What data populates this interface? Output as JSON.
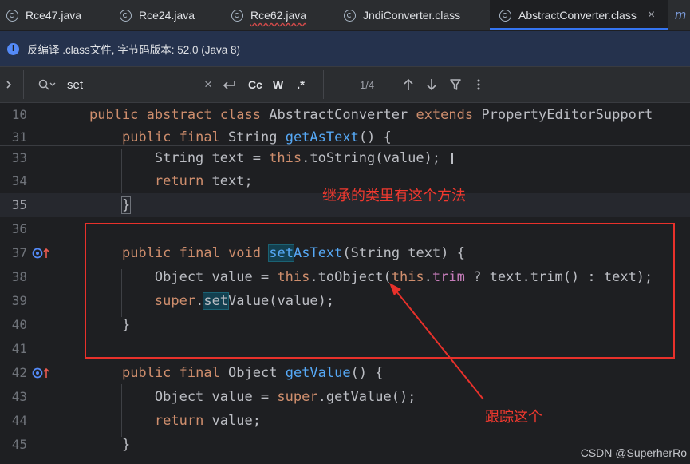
{
  "tabs": [
    {
      "label": "Rce47.java",
      "active": false,
      "error": false
    },
    {
      "label": "Rce24.java",
      "active": false,
      "error": false
    },
    {
      "label": "Rce62.java",
      "active": false,
      "error": true
    },
    {
      "label": "JndiConverter.class",
      "active": false,
      "error": false
    },
    {
      "label": "AbstractConverter.class",
      "active": true,
      "error": false
    }
  ],
  "tab_overflow_glyph": "m",
  "infobar": {
    "text": "反编译 .class文件, 字节码版本: 52.0 (Java 8)"
  },
  "search": {
    "query": "set",
    "match_count": "1/4",
    "case_toggle": "Cc",
    "word_toggle": "W",
    "regex_toggle": ".*"
  },
  "code_lines": [
    {
      "num": "10",
      "text": "public abstract class AbstractConverter extends PropertyEditorSupport"
    },
    {
      "num": "31",
      "text": "    public final String getAsText() {"
    },
    {
      "num": "33",
      "text": "        String text = this.toString(value);"
    },
    {
      "num": "34",
      "text": "        return text;"
    },
    {
      "num": "35",
      "text": "    }"
    },
    {
      "num": "36",
      "text": ""
    },
    {
      "num": "37",
      "text": "    public final void setAsText(String text) {"
    },
    {
      "num": "38",
      "text": "        Object value = this.toObject(this.trim ? text.trim() : text);"
    },
    {
      "num": "39",
      "text": "        super.setValue(value);"
    },
    {
      "num": "40",
      "text": "    }"
    },
    {
      "num": "41",
      "text": ""
    },
    {
      "num": "42",
      "text": "    public final Object getValue() {"
    },
    {
      "num": "43",
      "text": "        Object value = super.getValue();"
    },
    {
      "num": "44",
      "text": "        return value;"
    },
    {
      "num": "45",
      "text": "    }"
    }
  ],
  "annotations": {
    "note1": "继承的类里有这个方法",
    "note2": "跟踪这个"
  },
  "watermark": "CSDN @SuperherRo",
  "colors": {
    "annotation": "#e8312b",
    "keyword": "#cf8e6d",
    "method": "#56a8f5",
    "field": "#c77dbb",
    "search_hit": "#134050",
    "accent": "#3574f0"
  }
}
